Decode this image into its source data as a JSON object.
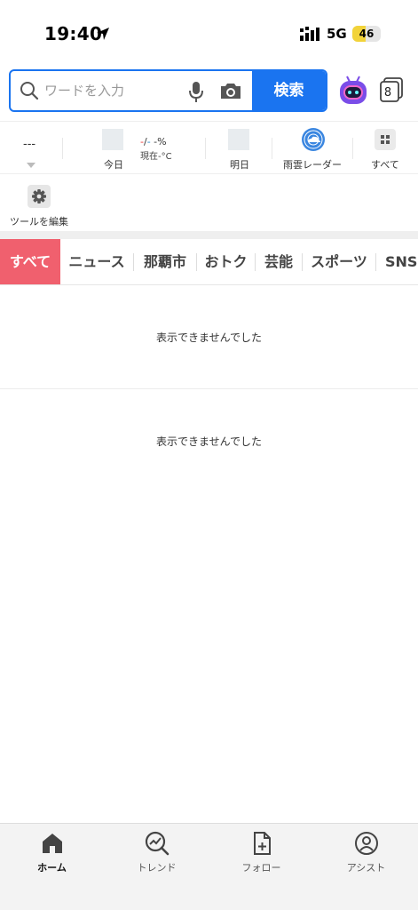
{
  "status_bar": {
    "time": "19:40",
    "network": "5G",
    "battery": "46",
    "battery_level": 0.46
  },
  "search": {
    "placeholder": "ワードを入力",
    "button_label": "検索",
    "tab_count": "8"
  },
  "tools": {
    "dash": "---",
    "today_label": "今日",
    "rain_red": "-",
    "rain_sep": "/",
    "rain_blue": "-",
    "rain_unit": " -%",
    "temp": "現在-°C",
    "tomorrow_label": "明日",
    "radar_label": "雨雲レーダー",
    "all_label": "すべて",
    "edit_label": "ツールを編集"
  },
  "categories": [
    {
      "label": "すべて"
    },
    {
      "label": "ニュース"
    },
    {
      "label": "那覇市"
    },
    {
      "label": "おトク"
    },
    {
      "label": "芸能"
    },
    {
      "label": "スポーツ"
    },
    {
      "label": "SNS"
    }
  ],
  "content": {
    "message_1": "表示できませんでした",
    "message_2": "表示できませんでした"
  },
  "bottom_nav": [
    {
      "label": "ホーム"
    },
    {
      "label": "トレンド"
    },
    {
      "label": "フォロー"
    },
    {
      "label": "アシスト"
    }
  ],
  "colors": {
    "accent": "#1a74f0",
    "category_active": "#f0606e",
    "battery": "#f2d33a"
  }
}
